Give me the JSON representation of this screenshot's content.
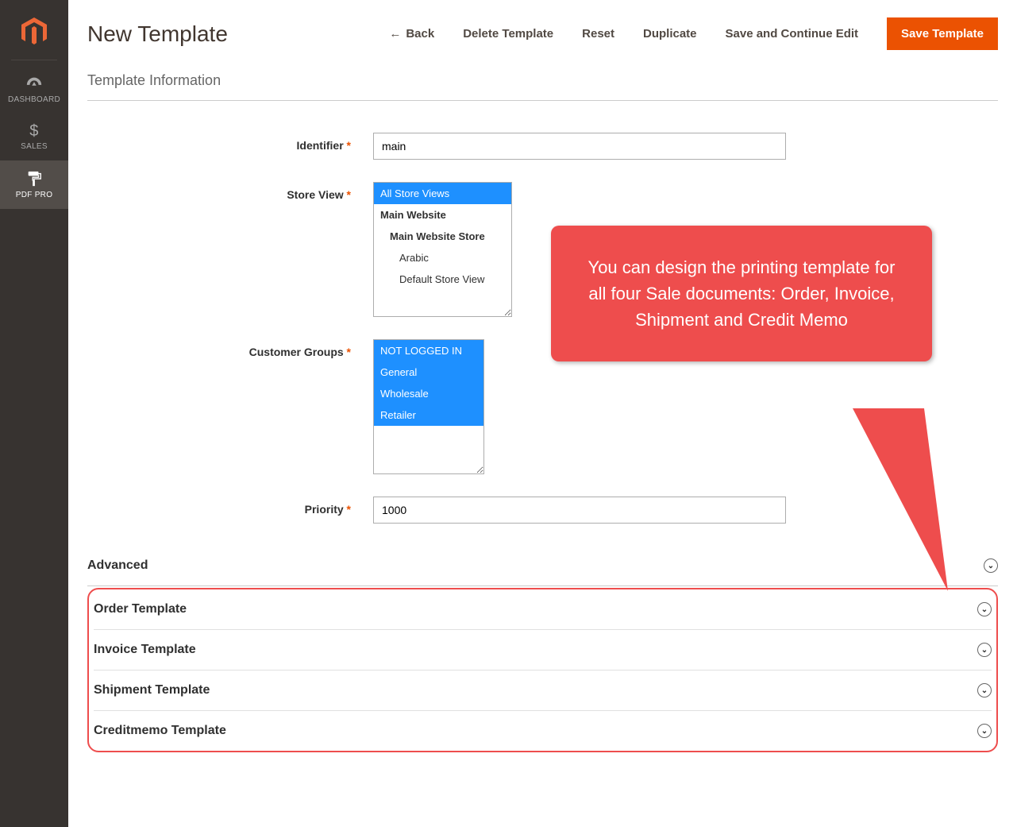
{
  "sidebar": {
    "items": [
      {
        "label": "DASHBOARD"
      },
      {
        "label": "SALES"
      },
      {
        "label": "PDF PRO"
      }
    ]
  },
  "header": {
    "title": "New Template",
    "actions": {
      "back": "Back",
      "delete": "Delete Template",
      "reset": "Reset",
      "duplicate": "Duplicate",
      "save_continue": "Save and Continue Edit",
      "save": "Save Template"
    }
  },
  "section": {
    "title": "Template Information"
  },
  "fields": {
    "identifier": {
      "label": "Identifier",
      "value": "main"
    },
    "store_view": {
      "label": "Store View",
      "options": [
        {
          "label": "All Store Views",
          "selected": true,
          "level": 0
        },
        {
          "label": "Main Website",
          "selected": false,
          "level": 0,
          "bold": true
        },
        {
          "label": "Main Website Store",
          "selected": false,
          "level": 1,
          "bold": true
        },
        {
          "label": "Arabic",
          "selected": false,
          "level": 2
        },
        {
          "label": "Default Store View",
          "selected": false,
          "level": 2
        }
      ]
    },
    "customer_groups": {
      "label": "Customer Groups",
      "options": [
        {
          "label": "NOT LOGGED IN",
          "selected": true
        },
        {
          "label": "General",
          "selected": true
        },
        {
          "label": "Wholesale",
          "selected": true
        },
        {
          "label": "Retailer",
          "selected": true
        }
      ]
    },
    "priority": {
      "label": "Priority",
      "value": "1000"
    }
  },
  "fieldsets": {
    "advanced": "Advanced",
    "order": "Order Template",
    "invoice": "Invoice Template",
    "shipment": "Shipment Template",
    "creditmemo": "Creditmemo Template"
  },
  "callout": {
    "text": "You can design the printing template for all four Sale documents: Order, Invoice, Shipment and Credit Memo"
  }
}
